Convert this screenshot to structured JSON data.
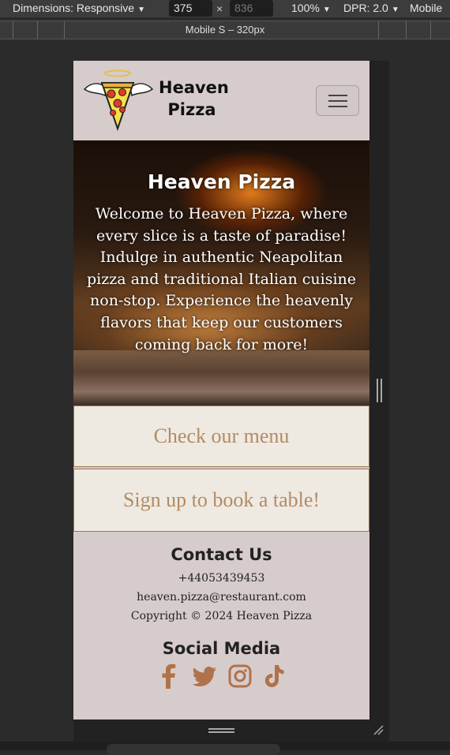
{
  "devtools": {
    "dimensions_label": "Dimensions: Responsive",
    "width_value": "375",
    "height_value": "836",
    "zoom_label": "100%",
    "dpr_label": "DPR: 2.0",
    "device_mode_label": "Mobile",
    "times_glyph": "×",
    "ruler_label": "Mobile S – 320px"
  },
  "site": {
    "brand_line1": "Heaven",
    "brand_line2": "Pizza",
    "hero": {
      "title": "Heaven Pizza",
      "text": "Welcome to Heaven Pizza, where every slice is a taste of paradise! Indulge in authentic Neapolitan pizza and traditional Italian cuisine non-stop. Experience the heavenly flavors that keep our customers coming back for more!"
    },
    "cta_menu": "Check our menu",
    "cta_book": "Sign up to book a table!",
    "contact": {
      "title": "Contact Us",
      "phone": "+44053439453",
      "email": "heaven.pizza@restaurant.com",
      "copyright": "Copyright © 2024 Heaven Pizza"
    },
    "social": {
      "title": "Social Media",
      "icons": [
        "facebook-icon",
        "twitter-icon",
        "instagram-icon",
        "tiktok-icon"
      ]
    }
  },
  "colors": {
    "page_bg": "#d7cccc",
    "cta_bg": "#eeeae2",
    "cta_text": "#b48a63",
    "social_icon": "#b0724a"
  }
}
